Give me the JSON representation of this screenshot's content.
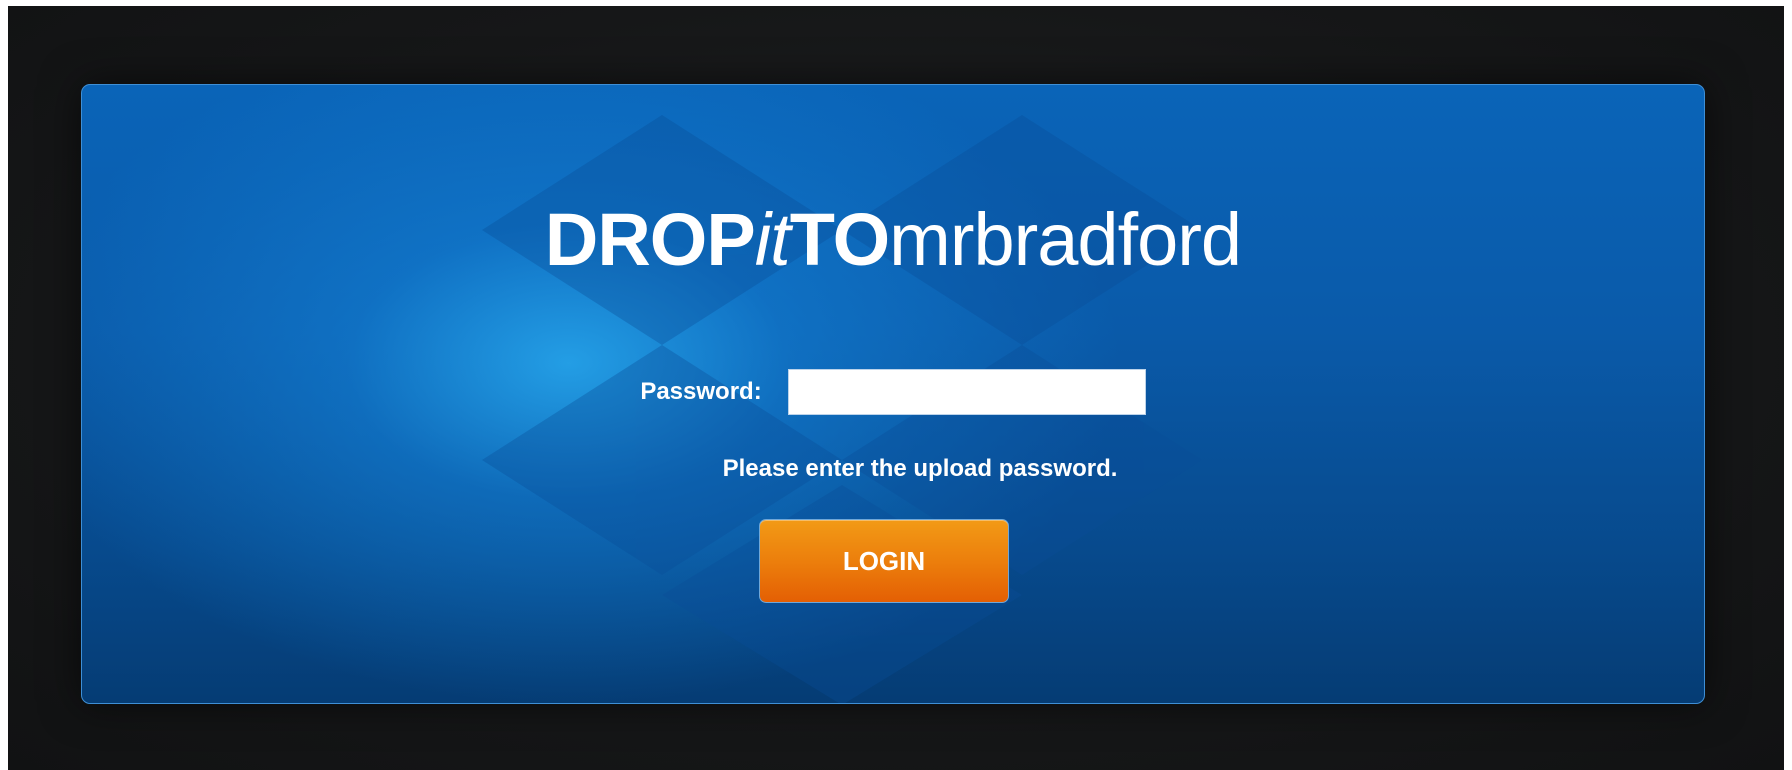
{
  "brand": {
    "part1": "DROP",
    "part2": "it",
    "part3": "TO",
    "part4": "mrbradford"
  },
  "form": {
    "password_label": "Password:",
    "password_value": "",
    "help_text": "Please enter the upload password.",
    "login_label": "LOGIN"
  },
  "colors": {
    "panel_blue": "#0a5aa9",
    "button_orange": "#ec7f0c",
    "background_dark": "#161718"
  }
}
